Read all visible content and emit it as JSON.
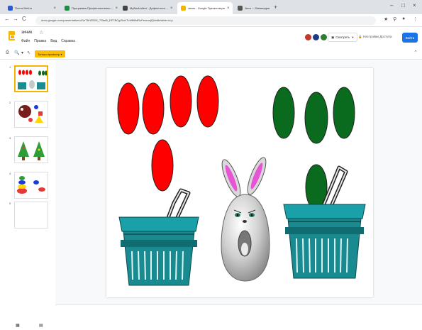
{
  "browser": {
    "tabs": [
      {
        "label": "Почта Mail.ru",
        "color": "#2a5bd7",
        "close": "×"
      },
      {
        "label": "Программа Профессиональн…",
        "color": "#1e8e3e",
        "close": "×"
      },
      {
        "label": "MyBusKollect · Дефектолог…",
        "color": "#444444",
        "close": "×"
      },
      {
        "label": "зичик - Google Презентации",
        "color": "#f4b400",
        "close": "×"
      },
      {
        "label": "Звон — Википедия",
        "color": "#555555",
        "close": "×"
      }
    ],
    "new_tab": "+",
    "window_controls": [
      "–",
      "□",
      "×"
    ],
    "nav": [
      "←",
      "→",
      "C"
    ],
    "url": "docs.google.com/presentation/d/1eT6HS5ZA_7SteiB_EE7BCgISoHTvNMkMRxPehmnjIQ/edit#slide=id.p",
    "addr_icons": [
      "★",
      "⚲",
      "●",
      "⋮"
    ]
  },
  "app": {
    "title": "зичик",
    "star": "☆",
    "menus": [
      "Файл",
      "Правка",
      "Вид",
      "Справка"
    ],
    "avatars": [
      "#c0392b",
      "#1e3a8a",
      "#2e7d32"
    ],
    "watch_label": "Смотреть",
    "access_label": "Настройки Доступа",
    "login_label": "Войти"
  },
  "toolbar": {
    "icons": [
      "⎙",
      "🔍",
      "▾",
      "↖"
    ],
    "mode_label": "Только просмотр ▾",
    "collapse": "⌃"
  },
  "slides": {
    "numbers": [
      "1",
      "2",
      "3",
      "4",
      "5"
    ]
  },
  "view_toggles": [
    "▦",
    "▤"
  ],
  "colors": {
    "red_oval": "#ff0000",
    "green_oval": "#0a6b1f",
    "basket": "#1a8c92",
    "accent": "#1a73e8"
  }
}
